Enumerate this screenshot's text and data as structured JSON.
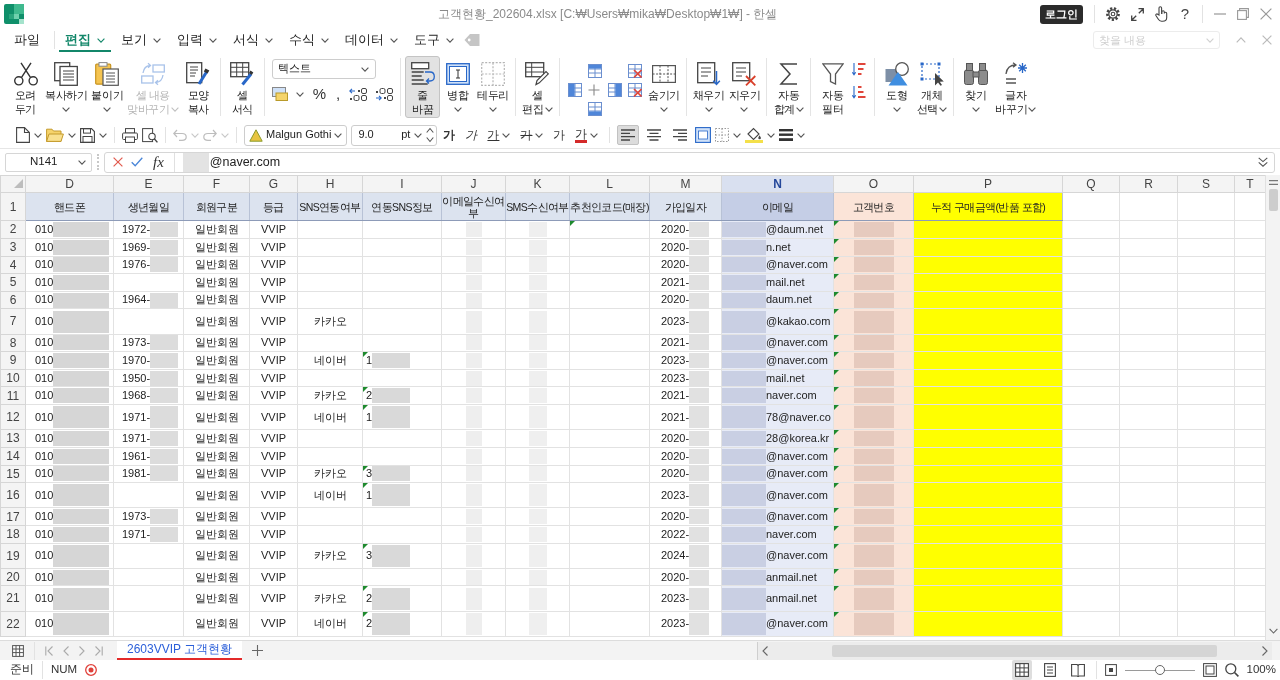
{
  "window": {
    "title": "고객현황_202604.xlsx [C:₩Users₩mika₩Desktop₩1₩] - 한셀",
    "login": "로그인",
    "help": "?"
  },
  "menu": {
    "items": [
      {
        "label": "파일",
        "selected": false,
        "caret": false
      },
      {
        "label": "편집",
        "selected": true,
        "caret": true
      },
      {
        "label": "보기",
        "selected": false,
        "caret": true
      },
      {
        "label": "입력",
        "selected": false,
        "caret": true
      },
      {
        "label": "서식",
        "selected": false,
        "caret": true
      },
      {
        "label": "수식",
        "selected": false,
        "caret": true
      },
      {
        "label": "데이터",
        "selected": false,
        "caret": true
      },
      {
        "label": "도구",
        "selected": false,
        "caret": true
      }
    ],
    "find": {
      "placeholder": "찾을 내용",
      "disabled": true
    }
  },
  "ribbon": {
    "groups": [
      [
        {
          "kind": "big",
          "label": "오려\n두기",
          "caret": false,
          "disabled": false,
          "pressed": false
        },
        {
          "kind": "big",
          "label": "복사하기",
          "caret": true,
          "disabled": false,
          "pressed": false
        },
        {
          "kind": "big",
          "label": "붙이기",
          "caret": true,
          "disabled": false,
          "pressed": false
        },
        {
          "kind": "big",
          "label": "셀 내용\n맞바꾸기",
          "caret": true,
          "disabled": true,
          "pressed": false
        },
        {
          "kind": "big",
          "label": "모양\n복사",
          "caret": false,
          "disabled": false,
          "pressed": false
        }
      ],
      [
        {
          "kind": "big",
          "label": "셀\n서식",
          "caret": false,
          "disabled": false,
          "pressed": false
        }
      ],
      [
        {
          "kind": "format",
          "value": "텍스트",
          "symbols": [
            "%",
            ","
          ]
        }
      ],
      [
        {
          "kind": "big",
          "label": "줄\n바꿈",
          "caret": false,
          "disabled": false,
          "pressed": true
        },
        {
          "kind": "big",
          "label": "병합",
          "caret": true,
          "disabled": false,
          "pressed": false
        },
        {
          "kind": "big",
          "label": "테두리",
          "caret": true,
          "disabled": false,
          "pressed": false
        }
      ],
      [
        {
          "kind": "big",
          "label": "셀\n편집",
          "caret": true,
          "disabled": false,
          "pressed": false
        }
      ],
      [
        {
          "kind": "cluster"
        },
        {
          "kind": "big",
          "label": "숨기기",
          "caret": true,
          "disabled": false,
          "pressed": false
        }
      ],
      [
        {
          "kind": "big",
          "label": "채우기",
          "caret": true,
          "disabled": false,
          "pressed": false
        },
        {
          "kind": "big",
          "label": "지우기",
          "caret": true,
          "disabled": false,
          "pressed": false
        }
      ],
      [
        {
          "kind": "big",
          "label": "자동\n합계",
          "caret": true,
          "disabled": false,
          "pressed": false
        }
      ],
      [
        {
          "kind": "big",
          "label": "자동\n필터",
          "caret": false,
          "disabled": false,
          "pressed": false
        },
        {
          "kind": "sort"
        }
      ],
      [
        {
          "kind": "big",
          "label": "도형",
          "caret": true,
          "disabled": false,
          "pressed": false
        },
        {
          "kind": "big",
          "label": "개체\n선택",
          "caret": true,
          "disabled": false,
          "pressed": false
        }
      ],
      [
        {
          "kind": "big",
          "label": "찾기",
          "caret": true,
          "disabled": false,
          "pressed": false
        },
        {
          "kind": "big",
          "label": "글자\n바꾸기",
          "caret": true,
          "disabled": false,
          "pressed": false
        }
      ]
    ]
  },
  "toolbar": {
    "history": [
      {
        "disabled": true
      },
      {
        "disabled": true
      }
    ],
    "font": "Malgun Gothi",
    "size": "9.0",
    "unit": "pt",
    "styles": [
      {
        "kind": "bold",
        "label": "가",
        "caret": false
      },
      {
        "kind": "italic",
        "label": "가",
        "caret": false
      },
      {
        "kind": "underline",
        "label": "가",
        "caret": true
      },
      {
        "kind": "strike",
        "label": "가",
        "caret": true
      },
      {
        "kind": "plain",
        "label": "가",
        "caret": false
      },
      {
        "kind": "color",
        "label": "가",
        "caret": true
      }
    ],
    "alignment": [
      {
        "selected": true
      },
      {
        "selected": false
      },
      {
        "selected": false
      }
    ]
  },
  "formula_bar": {
    "cell": "N141",
    "fx": "fx",
    "value": "@naver.com",
    "redacted": true
  },
  "sheet": {
    "columns": [
      {
        "letter": "D",
        "selected": false,
        "kind": "masked_tail"
      },
      {
        "letter": "E",
        "selected": false,
        "kind": "masked_tail"
      },
      {
        "letter": "F",
        "selected": false,
        "kind": "plain"
      },
      {
        "letter": "G",
        "selected": false,
        "kind": "plain"
      },
      {
        "letter": "H",
        "selected": false,
        "kind": "plain"
      },
      {
        "letter": "I",
        "selected": false,
        "kind": "masked_tail"
      },
      {
        "letter": "J",
        "selected": false,
        "kind": "faint"
      },
      {
        "letter": "K",
        "selected": false,
        "kind": "faint"
      },
      {
        "letter": "L",
        "selected": false,
        "kind": "plain"
      },
      {
        "letter": "M",
        "selected": false,
        "kind": "masked_tail"
      },
      {
        "letter": "N",
        "selected": true,
        "kind": "masked_head"
      },
      {
        "letter": "O",
        "selected": false,
        "kind": "masked",
        "color": "#fbe4d8"
      },
      {
        "letter": "P",
        "selected": false,
        "kind": "plain",
        "color": "#ffff00"
      },
      {
        "letter": "Q",
        "selected": false
      },
      {
        "letter": "R",
        "selected": false
      },
      {
        "letter": "S",
        "selected": false
      },
      {
        "letter": "T",
        "selected": false
      }
    ],
    "rows": [
      {
        "number": "1",
        "kind": "header",
        "tall": true,
        "cells": [
          {
            "text": "핸드폰",
            "flagged": false
          },
          {
            "text": "생년월일",
            "flagged": false
          },
          {
            "text": "회원구분",
            "flagged": false
          },
          {
            "text": "등급",
            "flagged": false
          },
          {
            "text": "SNS연동여부",
            "flagged": false
          },
          {
            "text": "연동SNS정보",
            "flagged": false
          },
          {
            "text": "이메일수신여부",
            "flagged": false
          },
          {
            "text": "SMS수신여부",
            "flagged": false
          },
          {
            "text": "추천인코드(매장)",
            "flagged": false
          },
          {
            "text": "가입일자",
            "flagged": false
          },
          {
            "text": "이메일",
            "flagged": false
          },
          {
            "text": "고객번호",
            "flagged": false
          },
          {
            "text": "누적 구매금액(반품 포함)",
            "flagged": false
          }
        ]
      },
      {
        "number": "2",
        "kind": "data",
        "tall": false,
        "cells": [
          {
            "text": "010",
            "flagged": false
          },
          {
            "text": "1972-",
            "flagged": false
          },
          {
            "text": "일반회원",
            "flagged": false
          },
          {
            "text": "VVIP",
            "flagged": false
          },
          {
            "flagged": false
          },
          {
            "flagged": false
          },
          {
            "flagged": false
          },
          {
            "flagged": false
          },
          {
            "flagged": true
          },
          {
            "text": "2020-",
            "flagged": false
          },
          {
            "text": "@daum.net",
            "flagged": false
          },
          {
            "flagged": true
          },
          {
            "flagged": false
          }
        ]
      },
      {
        "number": "3",
        "kind": "data",
        "tall": false,
        "cells": [
          {
            "text": "010",
            "flagged": false
          },
          {
            "text": "1969-",
            "flagged": false
          },
          {
            "text": "일반회원",
            "flagged": false
          },
          {
            "text": "VVIP",
            "flagged": false
          },
          {
            "flagged": false
          },
          {
            "flagged": false
          },
          {
            "flagged": false
          },
          {
            "flagged": false
          },
          {
            "flagged": false
          },
          {
            "text": "2020-",
            "flagged": false
          },
          {
            "text": "n.net",
            "flagged": false
          },
          {
            "flagged": true
          },
          {
            "flagged": false
          }
        ]
      },
      {
        "number": "4",
        "kind": "data",
        "tall": false,
        "cells": [
          {
            "text": "010",
            "flagged": false
          },
          {
            "text": "1976-",
            "flagged": false
          },
          {
            "text": "일반회원",
            "flagged": false
          },
          {
            "text": "VVIP",
            "flagged": false
          },
          {
            "flagged": false
          },
          {
            "flagged": false
          },
          {
            "flagged": false
          },
          {
            "flagged": false
          },
          {
            "flagged": false
          },
          {
            "text": "2020-",
            "flagged": false
          },
          {
            "text": "@naver.com",
            "flagged": false
          },
          {
            "flagged": true
          },
          {
            "flagged": false
          }
        ]
      },
      {
        "number": "5",
        "kind": "data",
        "tall": false,
        "cells": [
          {
            "text": "010",
            "flagged": false
          },
          {
            "flagged": false
          },
          {
            "text": "일반회원",
            "flagged": false
          },
          {
            "text": "VVIP",
            "flagged": false
          },
          {
            "flagged": false
          },
          {
            "flagged": false
          },
          {
            "flagged": false
          },
          {
            "flagged": false
          },
          {
            "flagged": false
          },
          {
            "text": "2021-",
            "flagged": false
          },
          {
            "text": "mail.net",
            "flagged": false
          },
          {
            "flagged": true
          },
          {
            "flagged": false
          }
        ]
      },
      {
        "number": "6",
        "kind": "data",
        "tall": false,
        "cells": [
          {
            "text": "010",
            "flagged": false
          },
          {
            "text": "1964-",
            "flagged": false
          },
          {
            "text": "일반회원",
            "flagged": false
          },
          {
            "text": "VVIP",
            "flagged": false
          },
          {
            "flagged": false
          },
          {
            "flagged": false
          },
          {
            "flagged": false
          },
          {
            "flagged": false
          },
          {
            "flagged": false
          },
          {
            "text": "2020-",
            "flagged": false
          },
          {
            "text": "daum.net",
            "flagged": false
          },
          {
            "flagged": true
          },
          {
            "flagged": false
          }
        ]
      },
      {
        "number": "7",
        "kind": "data",
        "tall": true,
        "cells": [
          {
            "text": "010",
            "flagged": false
          },
          {
            "flagged": false
          },
          {
            "text": "일반회원",
            "flagged": false
          },
          {
            "text": "VVIP",
            "flagged": false
          },
          {
            "text": "카카오",
            "flagged": false
          },
          {
            "flagged": false
          },
          {
            "flagged": false
          },
          {
            "flagged": false
          },
          {
            "flagged": false
          },
          {
            "text": "2023-",
            "flagged": false
          },
          {
            "text": "@kakao.com",
            "flagged": false
          },
          {
            "flagged": true
          },
          {
            "flagged": false
          }
        ]
      },
      {
        "number": "8",
        "kind": "data",
        "tall": false,
        "cells": [
          {
            "text": "010",
            "flagged": false
          },
          {
            "text": "1973-",
            "flagged": false
          },
          {
            "text": "일반회원",
            "flagged": false
          },
          {
            "text": "VVIP",
            "flagged": false
          },
          {
            "flagged": false
          },
          {
            "flagged": false
          },
          {
            "flagged": false
          },
          {
            "flagged": false
          },
          {
            "flagged": false
          },
          {
            "text": "2021-",
            "flagged": false
          },
          {
            "text": "@naver.com",
            "flagged": false
          },
          {
            "flagged": true
          },
          {
            "flagged": false
          }
        ]
      },
      {
        "number": "9",
        "kind": "data",
        "tall": false,
        "cells": [
          {
            "text": "010",
            "flagged": false
          },
          {
            "text": "1970-",
            "flagged": false
          },
          {
            "text": "일반회원",
            "flagged": false
          },
          {
            "text": "VVIP",
            "flagged": false
          },
          {
            "text": "네이버",
            "flagged": false
          },
          {
            "text": "1",
            "flagged": true
          },
          {
            "flagged": false
          },
          {
            "flagged": false
          },
          {
            "flagged": false
          },
          {
            "text": "2023-",
            "flagged": false
          },
          {
            "text": "@naver.com",
            "flagged": false
          },
          {
            "flagged": true
          },
          {
            "flagged": false
          }
        ]
      },
      {
        "number": "10",
        "kind": "data",
        "tall": false,
        "cells": [
          {
            "text": "010",
            "flagged": false
          },
          {
            "text": "1950-",
            "flagged": false
          },
          {
            "text": "일반회원",
            "flagged": false
          },
          {
            "text": "VVIP",
            "flagged": false
          },
          {
            "flagged": false
          },
          {
            "flagged": false
          },
          {
            "flagged": false
          },
          {
            "flagged": false
          },
          {
            "flagged": false
          },
          {
            "text": "2023-",
            "flagged": false
          },
          {
            "text": "mail.net",
            "flagged": false
          },
          {
            "flagged": true
          },
          {
            "flagged": false
          }
        ]
      },
      {
        "number": "11",
        "kind": "data",
        "tall": false,
        "cells": [
          {
            "text": "010",
            "flagged": false
          },
          {
            "text": "1968-",
            "flagged": false
          },
          {
            "text": "일반회원",
            "flagged": false
          },
          {
            "text": "VVIP",
            "flagged": false
          },
          {
            "text": "카카오",
            "flagged": false
          },
          {
            "text": "2",
            "flagged": true
          },
          {
            "flagged": false
          },
          {
            "flagged": false
          },
          {
            "flagged": false
          },
          {
            "text": "2021-",
            "flagged": false
          },
          {
            "text": "naver.com",
            "flagged": false
          },
          {
            "flagged": true
          },
          {
            "flagged": false
          }
        ]
      },
      {
        "number": "12",
        "kind": "data",
        "tall": true,
        "cells": [
          {
            "text": "010",
            "flagged": false
          },
          {
            "text": "1971-",
            "flagged": false
          },
          {
            "text": "일반회원",
            "flagged": false
          },
          {
            "text": "VVIP",
            "flagged": false
          },
          {
            "text": "네이버",
            "flagged": false
          },
          {
            "text": "1",
            "flagged": true
          },
          {
            "flagged": false
          },
          {
            "flagged": false
          },
          {
            "flagged": false
          },
          {
            "text": "2021-",
            "flagged": false
          },
          {
            "text": "78@naver.co",
            "flagged": false
          },
          {
            "flagged": true
          },
          {
            "flagged": false
          }
        ]
      },
      {
        "number": "13",
        "kind": "data",
        "tall": false,
        "cells": [
          {
            "text": "010",
            "flagged": false
          },
          {
            "text": "1971-",
            "flagged": false
          },
          {
            "text": "일반회원",
            "flagged": false
          },
          {
            "text": "VVIP",
            "flagged": false
          },
          {
            "flagged": false
          },
          {
            "flagged": false
          },
          {
            "flagged": false
          },
          {
            "flagged": false
          },
          {
            "flagged": false
          },
          {
            "text": "2020-",
            "flagged": false
          },
          {
            "text": "28@korea.kr",
            "flagged": false
          },
          {
            "flagged": true
          },
          {
            "flagged": false
          }
        ]
      },
      {
        "number": "14",
        "kind": "data",
        "tall": false,
        "cells": [
          {
            "text": "010",
            "flagged": false
          },
          {
            "text": "1961-",
            "flagged": false
          },
          {
            "text": "일반회원",
            "flagged": false
          },
          {
            "text": "VVIP",
            "flagged": false
          },
          {
            "flagged": false
          },
          {
            "flagged": false
          },
          {
            "flagged": false
          },
          {
            "flagged": false
          },
          {
            "flagged": false
          },
          {
            "text": "2020-",
            "flagged": false
          },
          {
            "text": "@naver.com",
            "flagged": false
          },
          {
            "flagged": true
          },
          {
            "flagged": false
          }
        ]
      },
      {
        "number": "15",
        "kind": "data",
        "tall": false,
        "cells": [
          {
            "text": "010",
            "flagged": false
          },
          {
            "text": "1981-",
            "flagged": false
          },
          {
            "text": "일반회원",
            "flagged": false
          },
          {
            "text": "VVIP",
            "flagged": false
          },
          {
            "text": "카카오",
            "flagged": false
          },
          {
            "text": "3",
            "flagged": true
          },
          {
            "flagged": false
          },
          {
            "flagged": false
          },
          {
            "flagged": false
          },
          {
            "text": "2020-",
            "flagged": false
          },
          {
            "text": "@naver.com",
            "flagged": false
          },
          {
            "flagged": true
          },
          {
            "flagged": false
          }
        ]
      },
      {
        "number": "16",
        "kind": "data",
        "tall": true,
        "cells": [
          {
            "text": "010",
            "flagged": false
          },
          {
            "flagged": false
          },
          {
            "text": "일반회원",
            "flagged": false
          },
          {
            "text": "VVIP",
            "flagged": false
          },
          {
            "text": "네이버",
            "flagged": false
          },
          {
            "text": "1",
            "flagged": true
          },
          {
            "flagged": false
          },
          {
            "flagged": false
          },
          {
            "flagged": false
          },
          {
            "text": "2023-",
            "flagged": false
          },
          {
            "text": "@naver.com",
            "flagged": false
          },
          {
            "flagged": true
          },
          {
            "flagged": false
          }
        ]
      },
      {
        "number": "17",
        "kind": "data",
        "tall": false,
        "cells": [
          {
            "text": "010",
            "flagged": false
          },
          {
            "text": "1973-",
            "flagged": false
          },
          {
            "text": "일반회원",
            "flagged": false
          },
          {
            "text": "VVIP",
            "flagged": false
          },
          {
            "flagged": false
          },
          {
            "flagged": false
          },
          {
            "flagged": false
          },
          {
            "flagged": false
          },
          {
            "flagged": false
          },
          {
            "text": "2020-",
            "flagged": false
          },
          {
            "text": "@naver.com",
            "flagged": false
          },
          {
            "flagged": true
          },
          {
            "flagged": false
          }
        ]
      },
      {
        "number": "18",
        "kind": "data",
        "tall": false,
        "cells": [
          {
            "text": "010",
            "flagged": false
          },
          {
            "text": "1971-",
            "flagged": false
          },
          {
            "text": "일반회원",
            "flagged": false
          },
          {
            "text": "VVIP",
            "flagged": false
          },
          {
            "flagged": false
          },
          {
            "flagged": false
          },
          {
            "flagged": false
          },
          {
            "flagged": false
          },
          {
            "flagged": false
          },
          {
            "text": "2022-",
            "flagged": false
          },
          {
            "text": "naver.com",
            "flagged": false
          },
          {
            "flagged": true
          },
          {
            "flagged": false
          }
        ]
      },
      {
        "number": "19",
        "kind": "data",
        "tall": true,
        "cells": [
          {
            "text": "010",
            "flagged": false
          },
          {
            "flagged": false
          },
          {
            "text": "일반회원",
            "flagged": false
          },
          {
            "text": "VVIP",
            "flagged": false
          },
          {
            "text": "카카오",
            "flagged": false
          },
          {
            "text": "3",
            "flagged": true
          },
          {
            "flagged": false
          },
          {
            "flagged": false
          },
          {
            "flagged": false
          },
          {
            "text": "2024-",
            "flagged": false
          },
          {
            "text": "@naver.com",
            "flagged": false
          },
          {
            "flagged": true
          },
          {
            "flagged": false
          }
        ]
      },
      {
        "number": "20",
        "kind": "data",
        "tall": false,
        "cells": [
          {
            "text": "010",
            "flagged": false
          },
          {
            "flagged": false
          },
          {
            "text": "일반회원",
            "flagged": false
          },
          {
            "text": "VVIP",
            "flagged": false
          },
          {
            "flagged": false
          },
          {
            "flagged": false
          },
          {
            "flagged": false
          },
          {
            "flagged": false
          },
          {
            "flagged": false
          },
          {
            "text": "2020-",
            "flagged": false
          },
          {
            "text": "anmail.net",
            "flagged": false
          },
          {
            "flagged": true
          },
          {
            "flagged": false
          }
        ]
      },
      {
        "number": "21",
        "kind": "data",
        "tall": true,
        "cells": [
          {
            "text": "010",
            "flagged": false
          },
          {
            "flagged": false
          },
          {
            "text": "일반회원",
            "flagged": false
          },
          {
            "text": "VVIP",
            "flagged": false
          },
          {
            "text": "카카오",
            "flagged": false
          },
          {
            "text": "2",
            "flagged": true
          },
          {
            "flagged": false
          },
          {
            "flagged": false
          },
          {
            "flagged": false
          },
          {
            "text": "2023-",
            "flagged": false
          },
          {
            "text": "anmail.net",
            "flagged": false
          },
          {
            "flagged": true
          },
          {
            "flagged": false
          }
        ]
      },
      {
        "number": "22",
        "kind": "data",
        "tall": true,
        "cells": [
          {
            "text": "010",
            "flagged": false
          },
          {
            "flagged": false
          },
          {
            "text": "일반회원",
            "flagged": false
          },
          {
            "text": "VVIP",
            "flagged": false
          },
          {
            "text": "네이버",
            "flagged": false
          },
          {
            "text": "2",
            "flagged": true
          },
          {
            "flagged": false
          },
          {
            "flagged": false
          },
          {
            "flagged": false
          },
          {
            "text": "2023-",
            "flagged": false
          },
          {
            "text": "@naver.com",
            "flagged": false
          },
          {
            "flagged": true
          },
          {
            "flagged": false
          }
        ]
      }
    ]
  },
  "sheet_tabs": [
    {
      "label": "2603VVIP 고객현황",
      "selected": true
    }
  ],
  "status_bar": {
    "mode": "준비",
    "num_lock": "NUM",
    "views": [
      {
        "selected": true
      },
      {
        "selected": false
      },
      {
        "selected": false
      }
    ],
    "zoom": {
      "level": 0.5,
      "reading": "100%"
    }
  }
}
